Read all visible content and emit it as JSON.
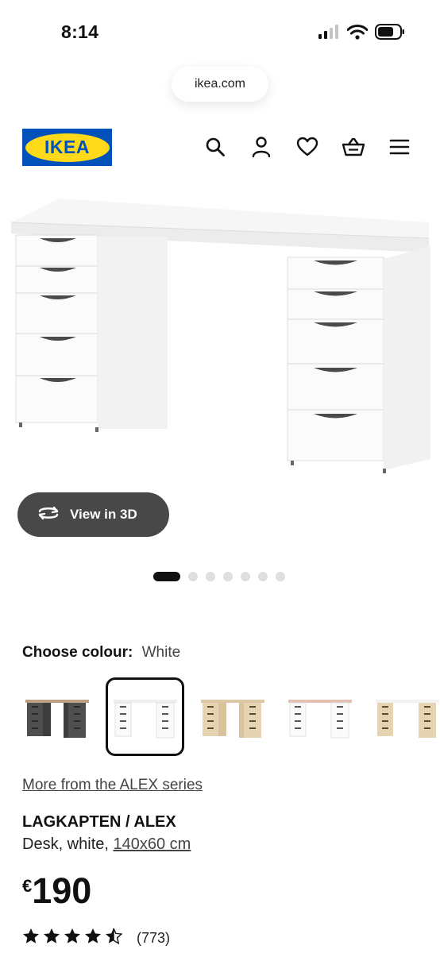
{
  "status_bar": {
    "time": "8:14"
  },
  "browser": {
    "url": "ikea.com"
  },
  "header": {
    "logo_text": "IKEA",
    "icons": [
      "search-icon",
      "account-icon",
      "heart-icon",
      "basket-icon",
      "menu-icon"
    ]
  },
  "gallery": {
    "view_3d_label": "View in 3D",
    "slide_count": 7,
    "active_slide": 1
  },
  "colour": {
    "label": "Choose colour:",
    "selected": "White",
    "options": [
      "dark grey",
      "white",
      "white stained oak",
      "white/pink",
      "white stained oak/white"
    ]
  },
  "product": {
    "series_link": "More from the ALEX series",
    "name": "LAGKAPTEN / ALEX",
    "description_prefix": "Desk, white, ",
    "dimensions": "140x60 cm",
    "currency": "€",
    "price": "190",
    "rating_value": 4.5,
    "review_count": "(773)"
  },
  "colors": {
    "ikea_blue": "#0051ba",
    "ikea_yellow": "#ffda1a",
    "button_dark": "#484848",
    "text": "#111111"
  }
}
